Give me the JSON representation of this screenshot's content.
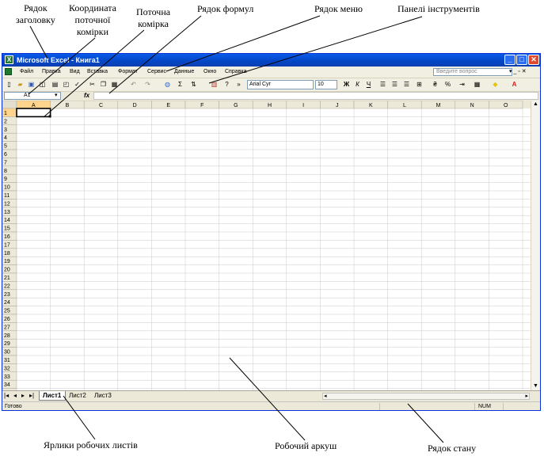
{
  "annotations": {
    "title_row": [
      "Рядок",
      "заголовку"
    ],
    "cell_coordinate": [
      "Координата",
      "поточної",
      "комірки"
    ],
    "current_cell": [
      "Поточна",
      "комірка"
    ],
    "formula_bar": "Рядок формул",
    "menu_bar": "Рядок меню",
    "toolbars": "Панелі інструментів",
    "sheet_tabs": "Ярлики робочих листів",
    "worksheet": "Робочий аркуш",
    "status_bar": "Рядок стану"
  },
  "window": {
    "title": "Microsoft Excel - Книга1",
    "minimize": "_",
    "maximize": "□",
    "close": "✕",
    "title_color": "#0a5ce8",
    "close_color": "#e04a2c"
  },
  "menu": {
    "items": [
      "Файл",
      "Правка",
      "Вид",
      "Вставка",
      "Формат",
      "Сервис",
      "Данные",
      "Окно",
      "Справка"
    ],
    "question_placeholder": "Введите вопрос",
    "doc_controls": "▾ _ ▫ ✕"
  },
  "toolbar": {
    "font": "Arial Cyr",
    "font_size": "10",
    "icons": [
      "new-icon",
      "open-icon",
      "save-icon",
      "permission-icon",
      "print-icon",
      "preview-icon",
      "spelling-icon",
      "cut-icon",
      "copy-icon",
      "paste-icon",
      "undo-icon",
      "redo-icon",
      "hyperlink-icon",
      "autosum-icon",
      "sort-icon",
      "chart-icon",
      "help-icon",
      "more-icon",
      "bold-icon",
      "italic-icon",
      "underline-icon",
      "align-left-icon",
      "align-center-icon",
      "align-right-icon",
      "merge-icon",
      "currency-icon",
      "percent-icon",
      "indent-icon",
      "borders-icon",
      "fill-color-icon",
      "font-color-icon"
    ],
    "bold": "Ж",
    "italic": "К",
    "underline": "Ч",
    "sigma": "Σ",
    "percent": "%"
  },
  "formula_bar": {
    "cell_ref": "A1",
    "fx": "fx",
    "value": ""
  },
  "grid": {
    "columns": [
      "A",
      "B",
      "C",
      "D",
      "E",
      "F",
      "G",
      "H",
      "I",
      "J",
      "K",
      "L",
      "M",
      "N",
      "O"
    ],
    "rows": [
      "1",
      "2",
      "3",
      "4",
      "5",
      "6",
      "7",
      "8",
      "9",
      "10",
      "11",
      "12",
      "13",
      "14",
      "15",
      "16",
      "17",
      "18",
      "19",
      "20",
      "21",
      "22",
      "23",
      "24",
      "25",
      "26",
      "27",
      "28",
      "29",
      "30",
      "31",
      "32",
      "33",
      "34",
      "35",
      "36"
    ],
    "active_cell": "A1"
  },
  "tabs": {
    "nav": [
      "|◂",
      "◂",
      "▸",
      "▸|"
    ],
    "sheets": [
      "Лист1",
      "Лист2",
      "Лист3"
    ],
    "active": "Лист1"
  },
  "status": {
    "ready": "Готово",
    "num": "NUM"
  }
}
